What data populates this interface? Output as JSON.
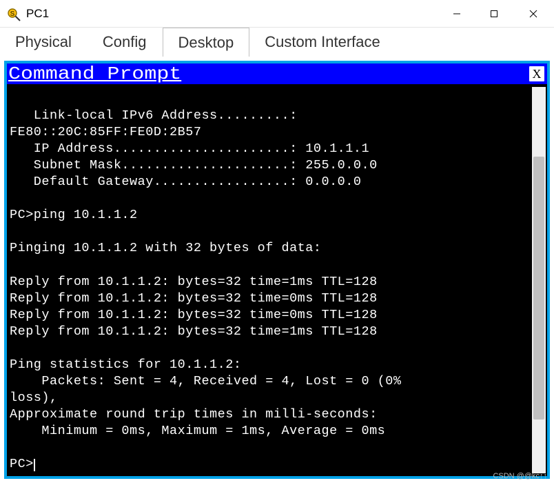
{
  "window": {
    "title": "PC1",
    "icon_name": "packet-tracer-icon"
  },
  "tabs": [
    {
      "label": "Physical",
      "active": false
    },
    {
      "label": "Config",
      "active": false
    },
    {
      "label": "Desktop",
      "active": true
    },
    {
      "label": "Custom Interface",
      "active": false
    }
  ],
  "command_prompt": {
    "title": "Command Prompt",
    "close_label": "X"
  },
  "terminal_lines": [
    "",
    "   Link-local IPv6 Address.........:",
    "FE80::20C:85FF:FE0D:2B57",
    "   IP Address......................: 10.1.1.1",
    "   Subnet Mask.....................: 255.0.0.0",
    "   Default Gateway.................: 0.0.0.0",
    "",
    "PC>ping 10.1.1.2",
    "",
    "Pinging 10.1.1.2 with 32 bytes of data:",
    "",
    "Reply from 10.1.1.2: bytes=32 time=1ms TTL=128",
    "Reply from 10.1.1.2: bytes=32 time=0ms TTL=128",
    "Reply from 10.1.1.2: bytes=32 time=0ms TTL=128",
    "Reply from 10.1.1.2: bytes=32 time=1ms TTL=128",
    "",
    "Ping statistics for 10.1.1.2:",
    "    Packets: Sent = 4, Received = 4, Lost = 0 (0%",
    "loss),",
    "Approximate round trip times in milli-seconds:",
    "    Minimum = 0ms, Maximum = 1ms, Average = 0ms",
    ""
  ],
  "terminal_prompt": "PC>",
  "watermark": "CSDN @@kc↑↑"
}
